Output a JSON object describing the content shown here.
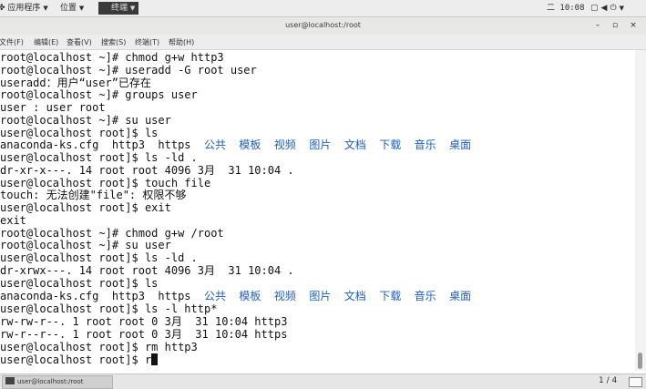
{
  "top_panel": {
    "applications": "应用程序",
    "places": "位置",
    "terminal_task": "终端",
    "clock": "二 10:08",
    "indicators": [
      "screen-icon",
      "volume-icon",
      "power-icon"
    ]
  },
  "window": {
    "title": "user@localhost:/root",
    "minimize": "–",
    "maximize": "▫",
    "close": "×"
  },
  "menubar": {
    "items": [
      "文件(F)",
      "编辑(E)",
      "查看(V)",
      "搜索(S)",
      "终端(T)",
      "帮助(H)"
    ]
  },
  "terminal": {
    "lines": [
      [
        "root@localhost ~]# chmod g+w http3"
      ],
      [
        "root@localhost ~]# useradd -G root user"
      ],
      [
        "useradd：用户“user”已存在"
      ],
      [
        "root@localhost ~]# groups user"
      ],
      [
        "user : user root"
      ],
      [
        "root@localhost ~]# su user"
      ],
      [
        "user@localhost root]$ ls"
      ],
      [
        "anaconda-ks.cfg  http3  https  ",
        "公共  模板  视频  图片  文档  下载  音乐  桌面"
      ],
      [
        "user@localhost root]$ ls -ld ."
      ],
      [
        "dr-xr-x---. 14 root root 4096 3月  31 10:04 ."
      ],
      [
        "user@localhost root]$ touch file"
      ],
      [
        "touch: 无法创建\"file\": 权限不够"
      ],
      [
        "user@localhost root]$ exit"
      ],
      [
        "exit"
      ],
      [
        "root@localhost ~]# chmod g+w /root"
      ],
      [
        "root@localhost ~]# su user"
      ],
      [
        "user@localhost root]$ ls -ld ."
      ],
      [
        "dr-xrwx---. 14 root root 4096 3月  31 10:04 ."
      ],
      [
        "user@localhost root]$ ls"
      ],
      [
        "anaconda-ks.cfg  http3  https  ",
        "公共  模板  视频  图片  文档  下载  音乐  桌面"
      ],
      [
        "user@localhost root]$ ls -l http*"
      ],
      [
        "rw-rw-r--. 1 root root 0 3月  31 10:04 http3"
      ],
      [
        "rw-r--r--. 1 root root 0 3月  31 10:04 https"
      ],
      [
        "user@localhost root]$ rm http3"
      ],
      [
        "user@localhost root]$ r"
      ]
    ]
  },
  "taskbar": {
    "task_label": "user@localhost:/root",
    "pager": "1 / 4"
  }
}
